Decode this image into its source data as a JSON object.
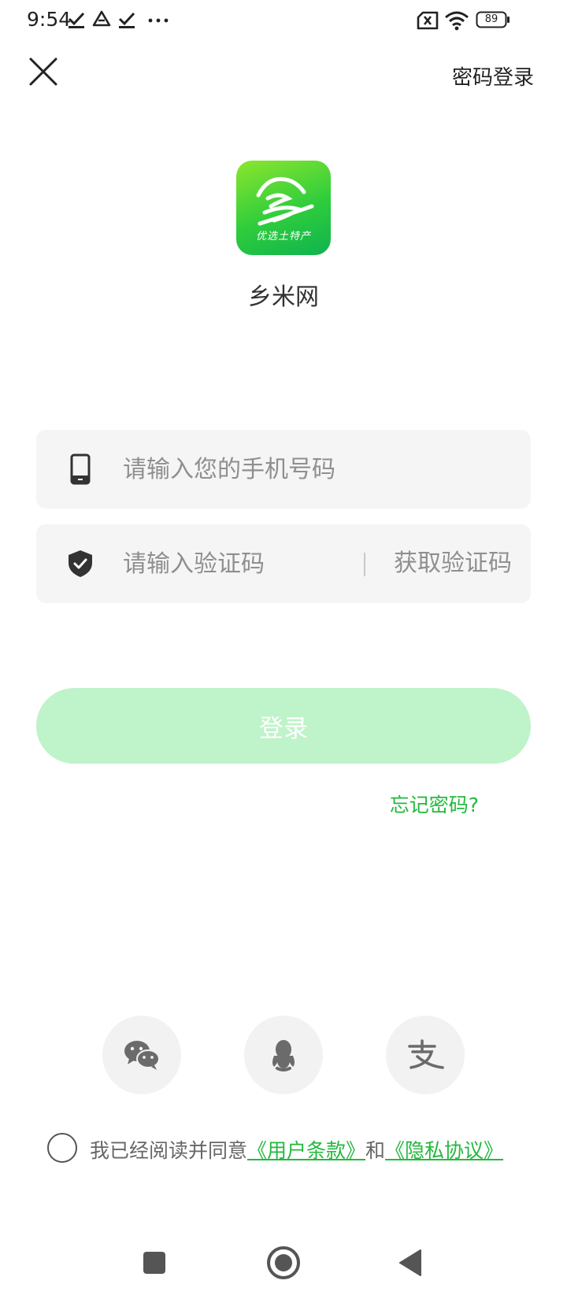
{
  "status_bar": {
    "time": "9:54",
    "battery": "89",
    "icons": [
      "check-download-icon",
      "drive-icon",
      "check-download-icon",
      "more-dots-icon",
      "sim-off-icon",
      "wifi-icon",
      "battery-icon"
    ]
  },
  "header": {
    "close_icon": "close-icon",
    "password_login": "密码登录"
  },
  "app": {
    "logo_subtitle": "优选土特产",
    "name": "乡米网"
  },
  "form": {
    "phone_placeholder": "请输入您的手机号码",
    "code_placeholder": "请输入验证码",
    "get_code_label": "获取验证码",
    "login_label": "登录",
    "forgot_label": "忘记密码?"
  },
  "social": {
    "items": [
      "wechat-icon",
      "qq-icon",
      "alipay-icon"
    ]
  },
  "agreement": {
    "prefix": "我已经阅读并同意",
    "terms": "《用户条款》",
    "and": "和",
    "privacy": "《隐私协议》"
  },
  "colors": {
    "accent": "#23b93e",
    "login_button_disabled": "#bff3c9",
    "input_background": "#f5f5f5"
  }
}
